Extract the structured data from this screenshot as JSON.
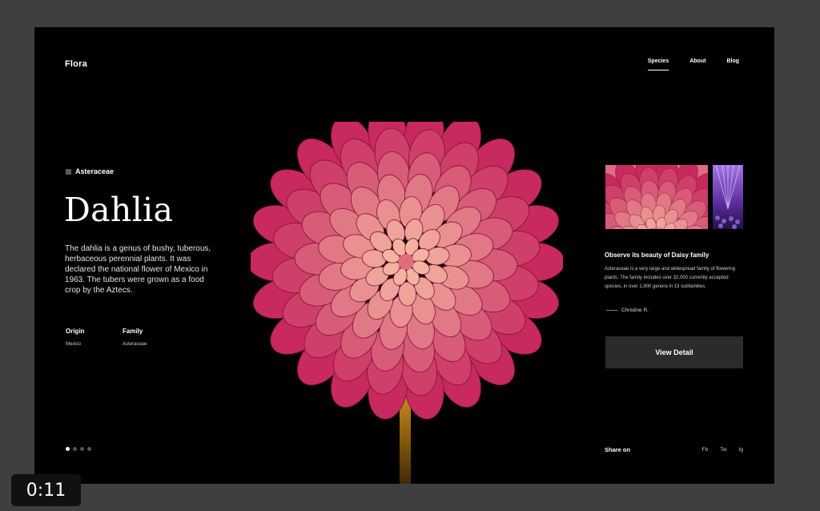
{
  "brand": {
    "logo": "Flora"
  },
  "nav": {
    "items": [
      "Species",
      "About",
      "Blog"
    ],
    "active": "Species"
  },
  "hero": {
    "family_tag": "Asteraceae",
    "title": "Dahlia",
    "description": "The dahlia is a genus of bushy, tuberous, herbaceous perennial plants. It was declared the national flower of Mexico in 1963. The tubers were grown as a food crop by the Aztecs.",
    "origin_label": "Origin",
    "origin_value": "Mexico",
    "family_label": "Family",
    "family_value": "Asteraceae"
  },
  "pagination": {
    "total": 4,
    "active_index": 0
  },
  "sidebar": {
    "quote_title": "Observe its beauty of Daisy family",
    "quote_text": "Asteraceae is a very large and widespread family of flowering plants. The family includes over 32,000 currently accepted species, in over 1,900 genera in 13 subfamilies.",
    "author": "Christine R.",
    "button_label": "View Detail"
  },
  "share": {
    "label": "Share on",
    "links": [
      "Fb",
      "Tw",
      "Ig"
    ]
  },
  "video": {
    "timestamp": "0:11"
  },
  "colors": {
    "background": "#000000",
    "outer": "#3f3f3f",
    "petal_dark": "#c8295f",
    "petal_light": "#f6b9a4",
    "stem": "#c98a16",
    "button": "#2b2b2b"
  }
}
